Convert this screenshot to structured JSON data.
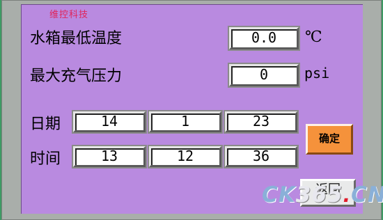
{
  "brand": "维控科技",
  "rows": {
    "water_tank_min_temp": {
      "label": "水箱最低温度",
      "value": "0.0",
      "unit": "℃"
    },
    "max_inflation_pressure": {
      "label": "最大充气压力",
      "value": "0",
      "unit": "psi"
    }
  },
  "date": {
    "label": "日期",
    "fields": [
      "14",
      "1",
      "23"
    ]
  },
  "time": {
    "label": "时间",
    "fields": [
      "13",
      "12",
      "36"
    ]
  },
  "buttons": {
    "confirm": "确定",
    "back": "返回"
  },
  "watermark": {
    "ck": "CK",
    "num": "365",
    "dot": ".",
    "cn": "CN"
  },
  "colors": {
    "screen": "#b98ae0",
    "confirm": "#f5923b",
    "bezel": "#a9aeaa"
  }
}
